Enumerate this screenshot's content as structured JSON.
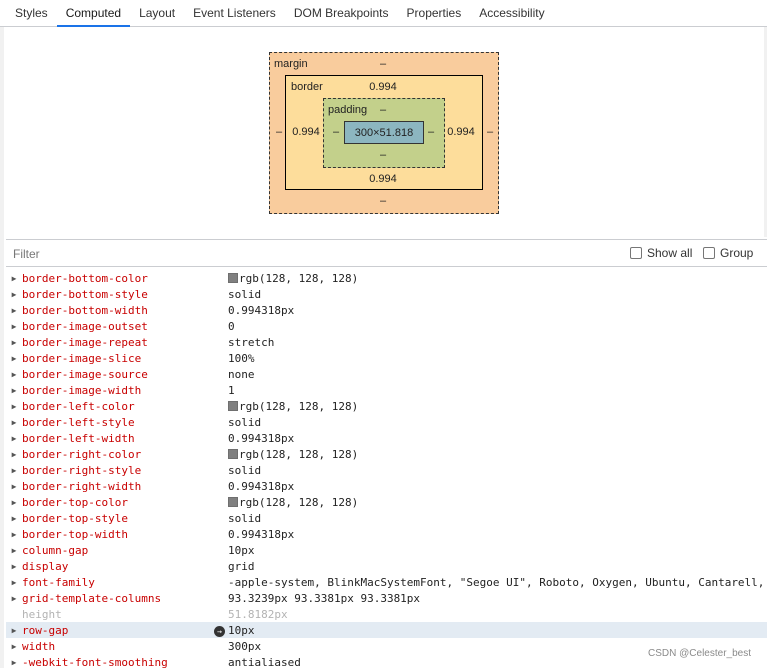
{
  "tabs": [
    {
      "label": "Styles"
    },
    {
      "label": "Computed",
      "active": true
    },
    {
      "label": "Layout"
    },
    {
      "label": "Event Listeners"
    },
    {
      "label": "DOM Breakpoints"
    },
    {
      "label": "Properties"
    },
    {
      "label": "Accessibility"
    }
  ],
  "box_model": {
    "margin_label": "margin",
    "margin_top": "–",
    "margin_left": "–",
    "margin_right": "–",
    "margin_bottom": "–",
    "border_label": "border",
    "border_top": "0.994",
    "border_left": "0.994",
    "border_right": "0.994",
    "border_bottom": "0.994",
    "padding_label": "padding",
    "padding_top": "–",
    "padding_left": "–",
    "padding_right": "–",
    "padding_bottom": "–",
    "content_size": "300×51.818",
    "colors": {
      "margin": "#f9cc9d",
      "border": "#fddd9b",
      "padding": "#c3d08b",
      "content": "#8cb6c0"
    }
  },
  "filter": {
    "placeholder": "Filter",
    "show_all_label": "Show all",
    "group_label": "Group"
  },
  "properties": [
    {
      "name": "border-bottom-color",
      "value": "rgb(128, 128, 128)",
      "swatch": true
    },
    {
      "name": "border-bottom-style",
      "value": "solid"
    },
    {
      "name": "border-bottom-width",
      "value": "0.994318px"
    },
    {
      "name": "border-image-outset",
      "value": "0"
    },
    {
      "name": "border-image-repeat",
      "value": "stretch"
    },
    {
      "name": "border-image-slice",
      "value": "100%"
    },
    {
      "name": "border-image-source",
      "value": "none"
    },
    {
      "name": "border-image-width",
      "value": "1"
    },
    {
      "name": "border-left-color",
      "value": "rgb(128, 128, 128)",
      "swatch": true
    },
    {
      "name": "border-left-style",
      "value": "solid"
    },
    {
      "name": "border-left-width",
      "value": "0.994318px"
    },
    {
      "name": "border-right-color",
      "value": "rgb(128, 128, 128)",
      "swatch": true
    },
    {
      "name": "border-right-style",
      "value": "solid"
    },
    {
      "name": "border-right-width",
      "value": "0.994318px"
    },
    {
      "name": "border-top-color",
      "value": "rgb(128, 128, 128)",
      "swatch": true
    },
    {
      "name": "border-top-style",
      "value": "solid"
    },
    {
      "name": "border-top-width",
      "value": "0.994318px"
    },
    {
      "name": "column-gap",
      "value": "10px"
    },
    {
      "name": "display",
      "value": "grid"
    },
    {
      "name": "font-family",
      "value": "-apple-system, BlinkMacSystemFont, \"Segoe UI\", Roboto, Oxygen, Ubuntu, Cantarell,"
    },
    {
      "name": "grid-template-columns",
      "value": "93.3239px 93.3381px 93.3381px"
    },
    {
      "name": "height",
      "value": "51.8182px",
      "dim": true,
      "no_arrow": true
    },
    {
      "name": "row-gap",
      "value": "10px",
      "highlight": true
    },
    {
      "name": "width",
      "value": "300px"
    },
    {
      "name": "-webkit-font-smoothing",
      "value": "antialiased"
    }
  ],
  "watermark": "CSDN @Celester_best"
}
